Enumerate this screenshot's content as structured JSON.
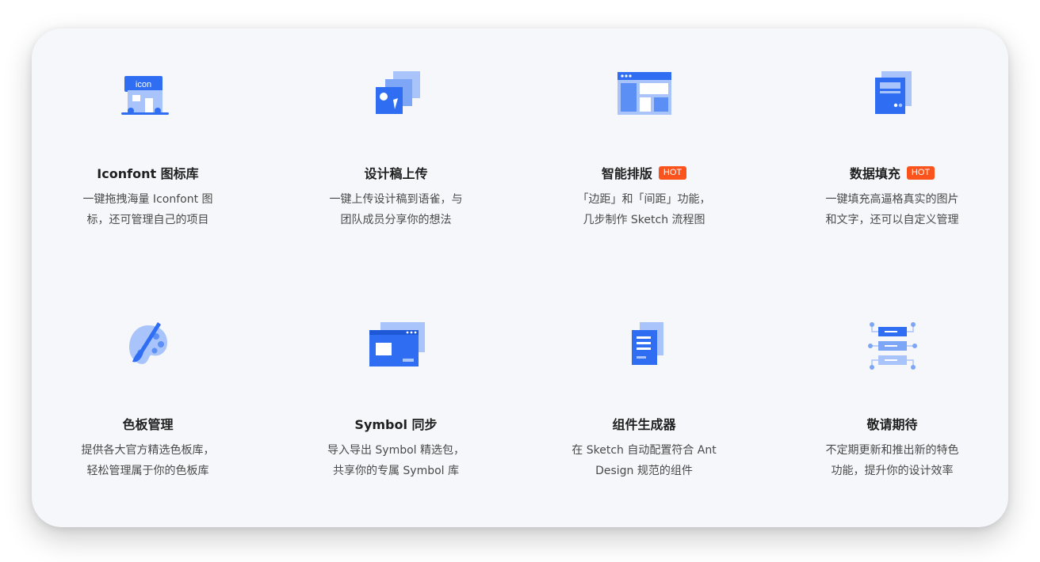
{
  "colors": {
    "primary": "#2f6ef3",
    "light": "#a9c4fa",
    "hot_badge": "#fa541c",
    "card_bg": "#f5f7fb"
  },
  "features": [
    {
      "icon": "store-icon",
      "icon_text": "icon",
      "title": "Iconfont 图标库",
      "hot": null,
      "desc": [
        "一键拖拽海量 Iconfont 图",
        "标，还可管理自己的项目"
      ]
    },
    {
      "icon": "upload-design-icon",
      "title": "设计稿上传",
      "hot": null,
      "desc": [
        "一键上传设计稿到语雀，与",
        "团队成员分享你的想法"
      ]
    },
    {
      "icon": "layout-icon",
      "title": "智能排版",
      "hot": "HOT",
      "desc": [
        "「边距」和「间距」功能，",
        "几步制作 Sketch 流程图"
      ]
    },
    {
      "icon": "data-fill-icon",
      "title": "数据填充",
      "hot": "HOT",
      "desc": [
        "一键填充高逼格真实的图片",
        "和文字，还可以自定义管理"
      ]
    },
    {
      "icon": "palette-icon",
      "title": "色板管理",
      "hot": null,
      "desc": [
        "提供各大官方精选色板库，",
        "轻松管理属于你的色板库"
      ]
    },
    {
      "icon": "symbol-window-icon",
      "title": "Symbol 同步",
      "hot": null,
      "desc": [
        "导入导出 Symbol 精选包，",
        "共享你的专属 Symbol 库"
      ]
    },
    {
      "icon": "document-icon",
      "title": "组件生成器",
      "hot": null,
      "desc": [
        "在 Sketch 自动配置符合 Ant",
        "Design 规范的组件"
      ]
    },
    {
      "icon": "network-servers-icon",
      "title": "敬请期待",
      "hot": null,
      "desc": [
        "不定期更新和推出新的特色",
        "功能，提升你的设计效率"
      ]
    }
  ]
}
